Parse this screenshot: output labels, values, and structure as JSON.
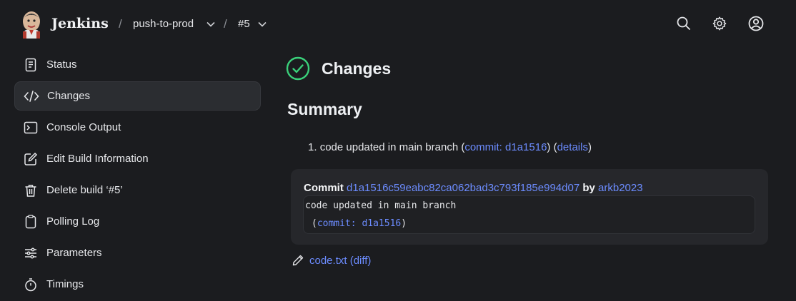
{
  "header": {
    "brand": "Jenkins",
    "breadcrumb": [
      {
        "label": "push-to-prod"
      },
      {
        "label": "#5"
      }
    ],
    "separator": "/",
    "icons": [
      "search-icon",
      "gear-icon",
      "user-icon"
    ]
  },
  "sidebar": {
    "items": [
      {
        "label": "Status",
        "icon": "status-icon",
        "active": false
      },
      {
        "label": "Changes",
        "icon": "code-icon",
        "active": true
      },
      {
        "label": "Console Output",
        "icon": "terminal-icon",
        "active": false
      },
      {
        "label": "Edit Build Information",
        "icon": "edit-icon",
        "active": false
      },
      {
        "label": "Delete build ‘#5’",
        "icon": "trash-icon",
        "active": false
      },
      {
        "label": "Polling Log",
        "icon": "clipboard-icon",
        "active": false
      },
      {
        "label": "Parameters",
        "icon": "sliders-icon",
        "active": false
      },
      {
        "label": "Timings",
        "icon": "stopwatch-icon",
        "active": false
      }
    ]
  },
  "main": {
    "title": "Changes",
    "summary_heading": "Summary",
    "change": {
      "number": "1.",
      "message": "code updated in main branch",
      "open_paren": "(",
      "commit_link": "commit: d1a1516",
      "mid": ") (",
      "details_link": "details",
      "close_paren": ")"
    },
    "commit": {
      "label": "Commit",
      "hash": "d1a1516c59eabc82ca062bad3c793f185e994d07",
      "by": "by",
      "author": "arkb2023",
      "message": "code updated in main branch",
      "open_paren": "(",
      "short_link": "commit: d1a1516",
      "close_paren": ")"
    },
    "file": {
      "name": "code.txt",
      "diff": "(diff)"
    }
  },
  "colors": {
    "background": "#1b1c1f",
    "link": "#6c8cff",
    "success": "#3ad07a"
  }
}
